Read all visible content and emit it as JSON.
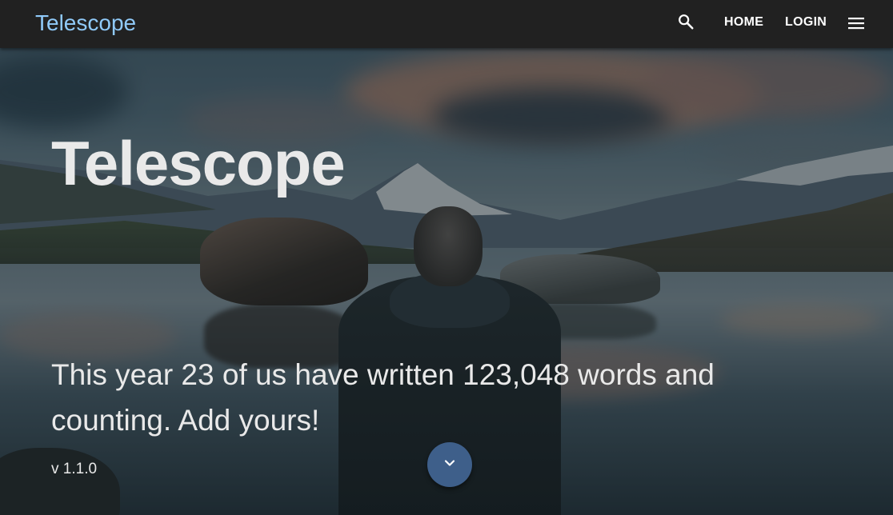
{
  "appbar": {
    "brand": "Telescope",
    "nav": {
      "home_label": "HOME",
      "login_label": "LOGIN"
    },
    "icons": {
      "search": "search-icon",
      "menu": "menu-icon"
    }
  },
  "hero": {
    "title": "Telescope",
    "stats_text": "This year 23 of us have written 123,048 words and counting. Add yours!",
    "version": "v 1.1.0",
    "scroll_icon": "chevron-down-icon"
  },
  "colors": {
    "appbar_bg": "#212121",
    "brand": "#90caf9",
    "fab": "#3e5f8a",
    "hero_text": "#e9e9e9"
  }
}
